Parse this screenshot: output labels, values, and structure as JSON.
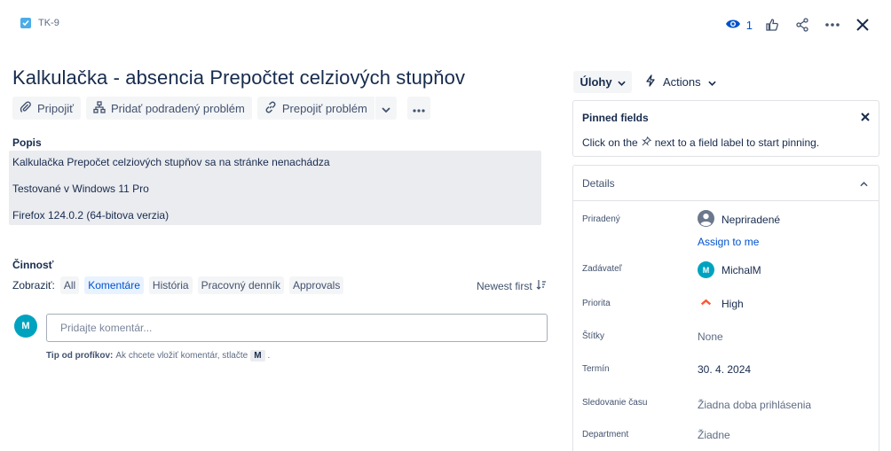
{
  "header": {
    "issue_key": "TK-9",
    "watch_count": "1"
  },
  "issue": {
    "title": "Kalkulačka - absencia Prepočtet celziových stupňov",
    "toolbar": {
      "attach": "Pripojiť",
      "add_child": "Pridať podradený problém",
      "link_issue": "Prepojiť problém"
    },
    "description_label": "Popis",
    "description_lines": [
      "Kalkulačka Prepočet celziových stupňov sa na stránke nenachádza",
      "Testované v Windows 11 Pro",
      "Firefox 124.0.2 (64-bitova verzia)"
    ]
  },
  "activity": {
    "label": "Činnosť",
    "show_label": "Zobraziť:",
    "filters": [
      "All",
      "Komentáre",
      "História",
      "Pracovný denník",
      "Approvals"
    ],
    "active_filter": "Komentáre",
    "sort": "Newest first",
    "comment_placeholder": "Pridajte komentár...",
    "avatar_initial": "M",
    "tip_bold": "Tip od profíkov:",
    "tip_text": "Ak chcete vložiť komentár, stlačte",
    "tip_key": "M",
    "tip_end": "."
  },
  "sidebar": {
    "status_button": "Úlohy",
    "actions_button": "Actions",
    "pinned": {
      "title": "Pinned fields",
      "text_before": "Click on the",
      "text_after": "next to a field label to start pinning."
    },
    "details": {
      "title": "Details",
      "fields": [
        {
          "label": "Priradený",
          "value": "Nepriradené",
          "link": "Assign to me"
        },
        {
          "label": "Zadávateľ",
          "value": "MichalM",
          "avatar": "M"
        },
        {
          "label": "Priorita",
          "value": "High"
        },
        {
          "label": "Štítky",
          "value": "None"
        },
        {
          "label": "Termín",
          "value": "30. 4. 2024"
        },
        {
          "label": "Sledovanie času",
          "value": "Žiadna doba prihlásenia"
        },
        {
          "label": "Department",
          "value": "Žiadne"
        }
      ]
    }
  },
  "colors": {
    "accent": "#0052cc",
    "avatar": "#00a3bf",
    "priority_high": "#ff5630",
    "checkbox": "#4bade8"
  }
}
